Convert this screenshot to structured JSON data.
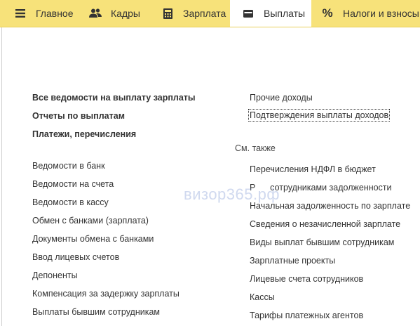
{
  "tabs": [
    {
      "label": "Главное",
      "icon": "menu-icon"
    },
    {
      "label": "Кадры",
      "icon": "people-icon"
    },
    {
      "label": "Зарплата",
      "icon": "calculator-icon"
    },
    {
      "label": "Выплаты",
      "icon": "wallet-icon",
      "active": true
    },
    {
      "label": "Налоги и взносы",
      "icon": "percent-icon"
    }
  ],
  "left_bold": [
    "Все ведомости на выплату зарплаты",
    "Отчеты по выплатам",
    "Платежи, перечисления"
  ],
  "left_links": [
    "Ведомости в банк",
    "Ведомости на счета",
    "Ведомости в кассу",
    "Обмен с банками (зарплата)",
    "Документы обмена с банками",
    "Ввод лицевых счетов",
    "Депоненты",
    "Компенсация за задержку зарплаты",
    "Выплаты бывшим сотрудникам"
  ],
  "right_top": [
    "Прочие доходы",
    "Подтверждения выплаты доходов"
  ],
  "see_also_label": "См. также",
  "right_links": [
    "Перечисления НДФЛ в бюджет",
    "Р      сотрудниками задолженности",
    "Начальная задолженность по зарплате",
    "Сведения о незачисленной зарплате",
    "Виды выплат бывшим сотрудникам",
    "Зарплатные проекты",
    "Лицевые счета сотрудников",
    "Кассы",
    "Тарифы платежных агентов"
  ],
  "watermark": "визор365.рф",
  "colors": {
    "topbar": "#f7e27a",
    "active_tab": "#ffffff",
    "text": "#333333"
  }
}
